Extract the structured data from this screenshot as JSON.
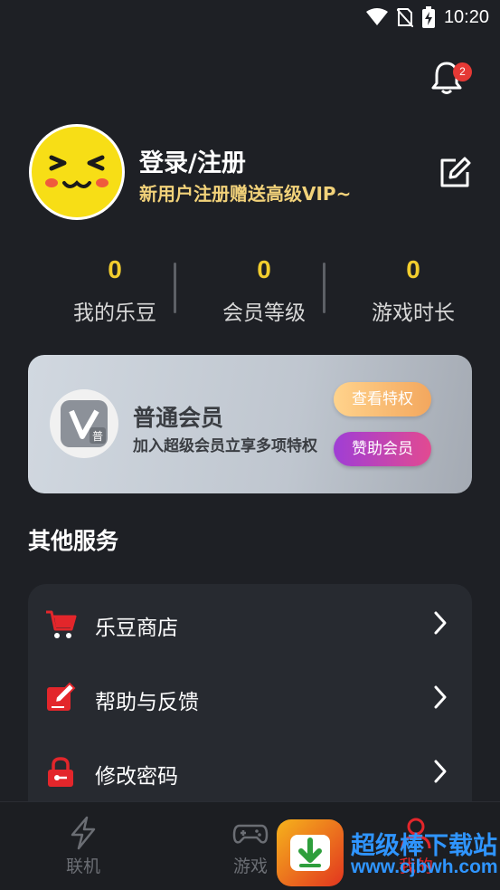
{
  "status_bar": {
    "time": "10:20"
  },
  "notifications": {
    "badge_count": "2"
  },
  "profile": {
    "title": "登录/注册",
    "subtitle": "新用户注册赠送高级VIP~"
  },
  "stats": [
    {
      "value": "0",
      "label": "我的乐豆"
    },
    {
      "value": "0",
      "label": "会员等级"
    },
    {
      "value": "0",
      "label": "游戏时长"
    }
  ],
  "membership": {
    "logo_mark": "普",
    "title": "普通会员",
    "description": "加入超级会员立享多项特权",
    "view_privileges_label": "查看特权",
    "sponsor_label": "赞助会员"
  },
  "services": {
    "title": "其他服务",
    "items": [
      {
        "label": "乐豆商店",
        "icon": "cart-icon"
      },
      {
        "label": "帮助与反馈",
        "icon": "feedback-icon"
      },
      {
        "label": "修改密码",
        "icon": "lock-icon"
      }
    ]
  },
  "tabs": [
    {
      "label": "联机",
      "icon": "lightning-icon"
    },
    {
      "label": "游戏",
      "icon": "gamepad-icon"
    },
    {
      "label": "我的",
      "icon": "user-icon"
    }
  ],
  "watermark": {
    "line1": "超级棒下载站",
    "line2": "www.cjbwh.com"
  },
  "colors": {
    "background": "#1e2025",
    "accent_yellow": "#f2cd2e",
    "subtitle_gold": "#f2d27a",
    "privilege_button": "#f3a75e",
    "sponsor_button": "#c044b0",
    "badge_red": "#e53935",
    "icon_red": "#e3262b"
  }
}
